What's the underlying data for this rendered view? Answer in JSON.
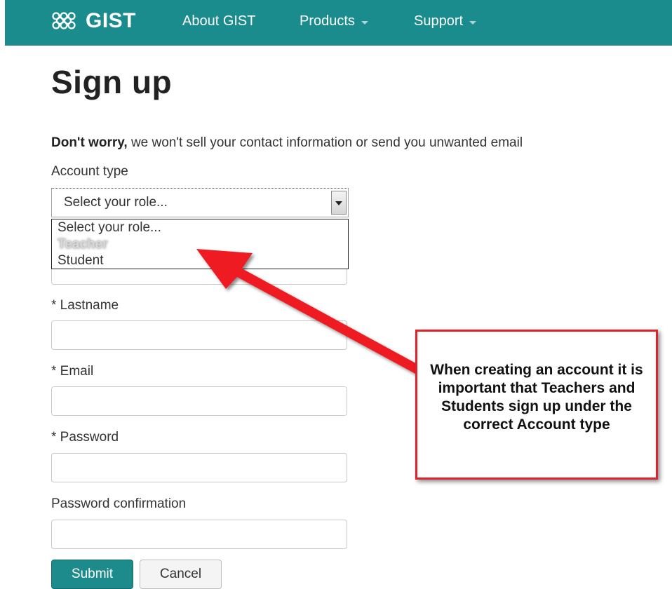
{
  "navbar": {
    "brand": "GIST",
    "items": [
      {
        "label": "About GIST",
        "has_caret": false
      },
      {
        "label": "Products",
        "has_caret": true
      },
      {
        "label": "Support",
        "has_caret": true
      }
    ],
    "bg_color": "#1b8c8e"
  },
  "page": {
    "title": "Sign up",
    "notice_bold": "Don't worry,",
    "notice_rest": " we won't sell your contact information or send you unwanted email"
  },
  "form": {
    "account_type_label": "Account type",
    "account_type_value": "Select your role...",
    "account_type_options": [
      "Select your role...",
      "Teacher",
      "Student"
    ],
    "lastname_label": "* Lastname",
    "email_label": "* Email",
    "password_label": "* Password",
    "password_confirmation_label": "Password confirmation",
    "submit_label": "Submit",
    "cancel_label": "Cancel"
  },
  "annotation": {
    "callout_text": "When creating an account it is important that Teachers and Students sign up under the correct Account type",
    "color": "#e0232a"
  }
}
